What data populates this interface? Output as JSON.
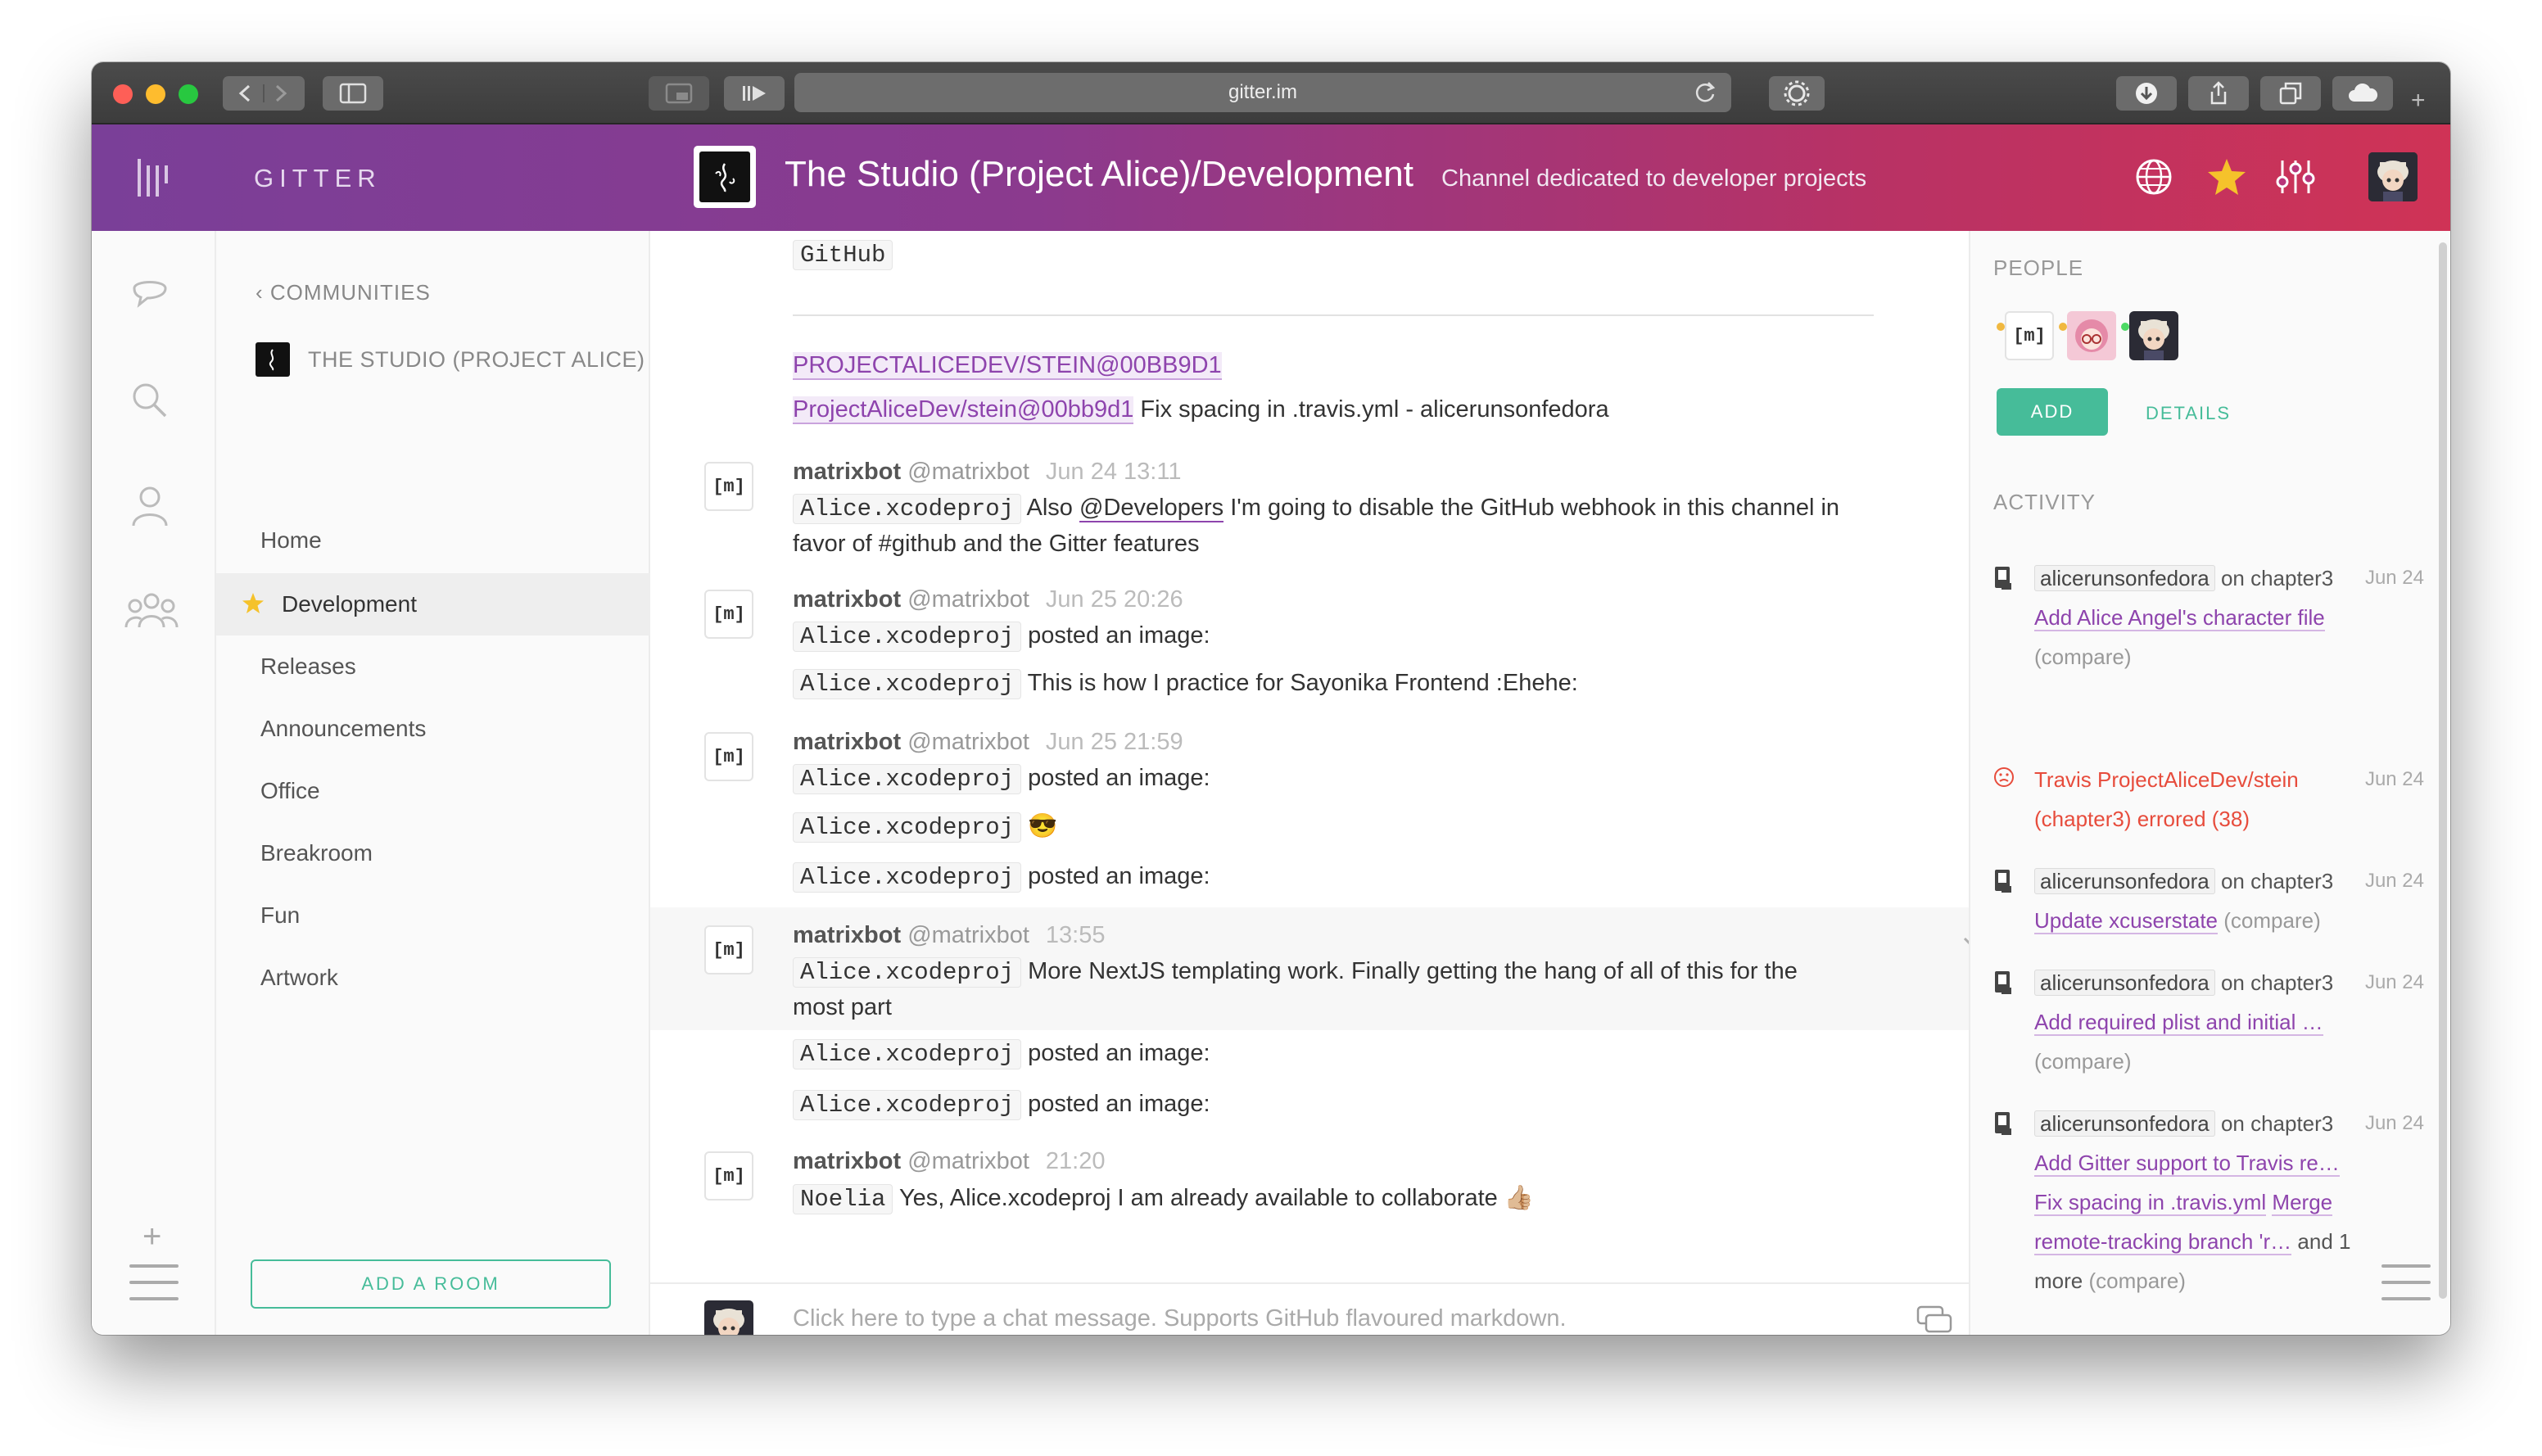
{
  "browser": {
    "url": "gitter.im"
  },
  "header": {
    "brand": "GITTER",
    "room_title": "The Studio (Project Alice)/Development",
    "room_topic": "Channel dedicated to developer projects"
  },
  "rooms": {
    "back_label": "COMMUNITIES",
    "community": "THE STUDIO (PROJECT ALICE)",
    "items": [
      {
        "label": "Home"
      },
      {
        "label": "Development"
      },
      {
        "label": "Releases"
      },
      {
        "label": "Announcements"
      },
      {
        "label": "Office"
      },
      {
        "label": "Breakroom"
      },
      {
        "label": "Fun"
      },
      {
        "label": "Artwork"
      }
    ],
    "add_room": "ADD A ROOM"
  },
  "chat": {
    "top_code": "GitHub",
    "commit_header": "PROJECTALICEDEV/STEIN@00BB9D1",
    "commit_link": "ProjectAliceDev/stein@00bb9d1",
    "commit_msg": "Fix spacing in .travis.yml - alicerunsonfedora",
    "avatar_text": "[m]",
    "bot_name": "matrixbot",
    "bot_user": "@matrixbot",
    "messages": [
      {
        "time": "Jun 24 13:11",
        "code": "Alice.xcodeproj",
        "pre": "Also",
        "mention": "@Developers",
        "text1": "I'm going to disable the GitHub webhook in this channel in",
        "text2": "favor of #github and the Gitter features"
      },
      {
        "time": "Jun 25 20:26",
        "code": "Alice.xcodeproj",
        "line1": "posted an image:",
        "code2": "Alice.xcodeproj",
        "line2": "This is how I practice for Sayonika Frontend :Ehehe:"
      },
      {
        "time": "Jun 25 21:59",
        "code": "Alice.xcodeproj",
        "line1": "posted an image:",
        "code2": "Alice.xcodeproj",
        "emoji": "😎",
        "code3": "Alice.xcodeproj",
        "line3": "posted an image:"
      },
      {
        "time": "13:55",
        "code": "Alice.xcodeproj",
        "text1": "More NextJS templating work. Finally getting the hang of all of this for the",
        "text2": "most part",
        "code2": "Alice.xcodeproj",
        "line2": "posted an image:",
        "code3": "Alice.xcodeproj",
        "line3": "posted an image:"
      },
      {
        "time": "21:20",
        "code": "Noelia",
        "text": "Yes, Alice.xcodeproj I am already available to collaborate",
        "emoji": "👍🏼"
      }
    ],
    "composer_placeholder": "Click here to type a chat message. Supports GitHub flavoured markdown."
  },
  "sidebar": {
    "people_label": "PEOPLE",
    "add_label": "ADD",
    "details_label": "DETAILS",
    "activity_label": "ACTIVITY",
    "activity": [
      {
        "user": "alicerunsonfedora",
        "branch": "on chapter3",
        "link": "Add Alice Angel's character file",
        "compare": "(compare)",
        "date": "Jun 24"
      },
      {
        "error1": "Travis ProjectAliceDev/stein",
        "error2": "(chapter3) errored (38)",
        "date": "Jun 24"
      },
      {
        "user": "alicerunsonfedora",
        "branch": "on chapter3",
        "link": "Update xcuserstate",
        "compare": "(compare)",
        "date": "Jun 24"
      },
      {
        "user": "alicerunsonfedora",
        "branch": "on chapter3",
        "link": "Add required plist and initial …",
        "compare": "(compare)",
        "date": "Jun 24"
      },
      {
        "user": "alicerunsonfedora",
        "branch": "on chapter3",
        "link1": "Add Gitter support to Travis re…",
        "link2": "Fix spacing in .travis.yml",
        "link3": "Merge",
        "link4": "remote-tracking branch 'r…",
        "and": "and 1",
        "more": "more",
        "compare": "(compare)",
        "date": "Jun 24"
      }
    ]
  },
  "colors": {
    "accent": "#46bc99",
    "link": "#8e44ad",
    "error": "#e74c3c",
    "header_start": "#7a3f98",
    "header_end": "#cf3356"
  }
}
